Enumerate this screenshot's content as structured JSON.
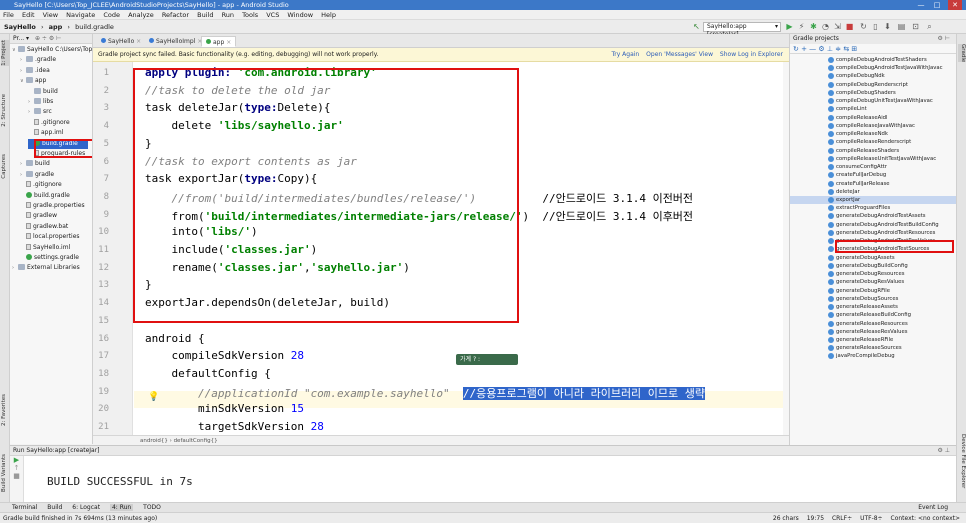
{
  "window": {
    "title": "SayHello [C:\\Users\\Top_JCLEE\\AndroidStudioProjects\\SayHello] - app - Android Studio",
    "minimize": "—",
    "maximize": "□",
    "close": "✕"
  },
  "menu": [
    "File",
    "Edit",
    "View",
    "Navigate",
    "Code",
    "Analyze",
    "Refactor",
    "Build",
    "Run",
    "Tools",
    "VCS",
    "Window",
    "Help"
  ],
  "breadcrumbs": [
    "SayHello",
    "app",
    "build.gradle"
  ],
  "run_config": "SayHello:app [createJar]",
  "left_tool_tabs": [
    "1: Project",
    "2: Structure",
    "Captures",
    "2: Favorites",
    "Build Variants"
  ],
  "right_tool_tabs": [
    "Gradle",
    "Device File Explorer"
  ],
  "project": {
    "header": "Pr... ▾",
    "tree": [
      {
        "label": "SayHello  C:\\Users\\Top",
        "indent": 0,
        "type": "folder",
        "arrow": "v"
      },
      {
        "label": ".gradle",
        "indent": 1,
        "type": "folder",
        "arrow": ">"
      },
      {
        "label": ".idea",
        "indent": 1,
        "type": "folder",
        "arrow": ">"
      },
      {
        "label": "app",
        "indent": 1,
        "type": "folder",
        "arrow": "v"
      },
      {
        "label": "build",
        "indent": 2,
        "type": "folder",
        "arrow": ""
      },
      {
        "label": "libs",
        "indent": 2,
        "type": "folder",
        "arrow": ">"
      },
      {
        "label": "src",
        "indent": 2,
        "type": "folder",
        "arrow": ">"
      },
      {
        "label": ".gitignore",
        "indent": 2,
        "type": "file",
        "arrow": ""
      },
      {
        "label": "app.iml",
        "indent": 2,
        "type": "file",
        "arrow": ""
      },
      {
        "label": "build.gradle",
        "indent": 2,
        "type": "gradle",
        "arrow": "",
        "selected": true
      },
      {
        "label": "proguard-rules",
        "indent": 2,
        "type": "file",
        "arrow": ""
      },
      {
        "label": "build",
        "indent": 1,
        "type": "folder",
        "arrow": ">"
      },
      {
        "label": "gradle",
        "indent": 1,
        "type": "folder",
        "arrow": ">"
      },
      {
        "label": ".gitignore",
        "indent": 1,
        "type": "file",
        "arrow": ""
      },
      {
        "label": "build.gradle",
        "indent": 1,
        "type": "gradle",
        "arrow": ""
      },
      {
        "label": "gradle.properties",
        "indent": 1,
        "type": "file",
        "arrow": ""
      },
      {
        "label": "gradlew",
        "indent": 1,
        "type": "file",
        "arrow": ""
      },
      {
        "label": "gradlew.bat",
        "indent": 1,
        "type": "file",
        "arrow": ""
      },
      {
        "label": "local.properties",
        "indent": 1,
        "type": "file",
        "arrow": ""
      },
      {
        "label": "SayHello.iml",
        "indent": 1,
        "type": "file",
        "arrow": ""
      },
      {
        "label": "settings.gradle",
        "indent": 1,
        "type": "gradle",
        "arrow": ""
      },
      {
        "label": "External Libraries",
        "indent": 0,
        "type": "folder",
        "arrow": ">"
      }
    ]
  },
  "tabs": [
    {
      "label": "SayHello",
      "active": false
    },
    {
      "label": "SayHelloImpl",
      "active": false
    },
    {
      "label": "app",
      "active": true
    }
  ],
  "sync_bar": {
    "message": "Gradle project sync failed. Basic functionality (e.g. editing, debugging) will not work properly.",
    "links": [
      "Try Again",
      "Open 'Messages' View",
      "Show Log in Explorer"
    ]
  },
  "code_lines": [
    {
      "n": "1",
      "tokens": [
        {
          "t": "apply plugin: ",
          "c": "kw"
        },
        {
          "t": "'com.android.library'",
          "c": "str"
        }
      ]
    },
    {
      "n": "2",
      "tokens": [
        {
          "t": "//task to delete the old jar",
          "c": "cmt"
        }
      ]
    },
    {
      "n": "3",
      "tokens": [
        {
          "t": "task deleteJar(",
          "c": ""
        },
        {
          "t": "type:",
          "c": "kw"
        },
        {
          "t": "Delete){",
          "c": ""
        }
      ]
    },
    {
      "n": "4",
      "tokens": [
        {
          "t": "    delete ",
          "c": ""
        },
        {
          "t": "'libs/sayhello.jar'",
          "c": "str"
        }
      ]
    },
    {
      "n": "5",
      "tokens": [
        {
          "t": "}",
          "c": ""
        }
      ]
    },
    {
      "n": "6",
      "tokens": [
        {
          "t": "//task to export contents as jar",
          "c": "cmt"
        }
      ]
    },
    {
      "n": "7",
      "tokens": [
        {
          "t": "task exportJar(",
          "c": ""
        },
        {
          "t": "type:",
          "c": "kw"
        },
        {
          "t": "Copy){",
          "c": ""
        }
      ]
    },
    {
      "n": "8",
      "tokens": [
        {
          "t": "    //from('build/intermediates/bundles/release/')",
          "c": "cmt"
        },
        {
          "t": "          //안드로이드 3.1.4 이전버전",
          "c": ""
        }
      ]
    },
    {
      "n": "9",
      "tokens": [
        {
          "t": "    from(",
          "c": ""
        },
        {
          "t": "'build/intermediates/intermediate-jars/release/'",
          "c": "str"
        },
        {
          "t": ")  //안드로이드 3.1.4 이후버전",
          "c": ""
        }
      ]
    },
    {
      "n": "10",
      "tokens": [
        {
          "t": "    into(",
          "c": ""
        },
        {
          "t": "'libs/'",
          "c": "str"
        },
        {
          "t": ")",
          "c": ""
        }
      ]
    },
    {
      "n": "11",
      "tokens": [
        {
          "t": "    include(",
          "c": ""
        },
        {
          "t": "'classes.jar'",
          "c": "str"
        },
        {
          "t": ")",
          "c": ""
        }
      ]
    },
    {
      "n": "12",
      "tokens": [
        {
          "t": "    rename(",
          "c": ""
        },
        {
          "t": "'classes.jar'",
          "c": "str"
        },
        {
          "t": ",",
          "c": ""
        },
        {
          "t": "'sayhello.jar'",
          "c": "str"
        },
        {
          "t": ")",
          "c": ""
        }
      ]
    },
    {
      "n": "13",
      "tokens": [
        {
          "t": "}",
          "c": ""
        }
      ]
    },
    {
      "n": "14",
      "tokens": [
        {
          "t": "exportJar.dependsOn(deleteJar, build)",
          "c": ""
        }
      ]
    },
    {
      "n": "15",
      "tokens": []
    },
    {
      "n": "16",
      "tokens": [
        {
          "t": "android {",
          "c": ""
        }
      ]
    },
    {
      "n": "17",
      "tokens": [
        {
          "t": "    compileSdkVersion ",
          "c": ""
        },
        {
          "t": "28",
          "c": "num"
        }
      ]
    },
    {
      "n": "18",
      "tokens": [
        {
          "t": "    defaultConfig {",
          "c": ""
        }
      ]
    },
    {
      "n": "19",
      "tokens": [
        {
          "t": "        //applicationId \"com.example.sayhello\"  ",
          "c": "cmt"
        },
        {
          "t": "//응용프로그램이 아니라 라이브러리 이므로 생략",
          "c": "hlcmt"
        }
      ]
    },
    {
      "n": "20",
      "tokens": [
        {
          "t": "        minSdkVersion ",
          "c": ""
        },
        {
          "t": "15",
          "c": "num"
        }
      ]
    },
    {
      "n": "21",
      "tokens": [
        {
          "t": "        targetSdkVersion ",
          "c": ""
        },
        {
          "t": "28",
          "c": "num"
        }
      ]
    }
  ],
  "popup_label": "가계 ? :",
  "editor_breadcrumb": "android{}  ›  defaultConfig{}",
  "gradle_panel": {
    "title": "Gradle projects",
    "tools": "↻  +  —  ⚙  ⊥  ≑  ⇆  ⊞",
    "tasks": [
      "compileDebugAndroidTestShaders",
      "compileDebugAndroidTestJavaWithJavac",
      "compileDebugNdk",
      "compileDebugRenderscript",
      "compileDebugShaders",
      "compileDebugUnitTestJavaWithJavac",
      "compileLint",
      "compileReleaseAidl",
      "compileReleaseJavaWithJavac",
      "compileReleaseNdk",
      "compileReleaseRenderscript",
      "compileReleaseShaders",
      "compileReleaseUnitTestJavaWithJavac",
      "consumeConfigAttr",
      "createFullJarDebug",
      "createFullJarRelease",
      "deleteJar",
      "exportJar",
      "extractProguardFiles",
      "generateDebugAndroidTestAssets",
      "generateDebugAndroidTestBuildConfig",
      "generateDebugAndroidTestResources",
      "generateDebugAndroidTestResValues",
      "generateDebugAndroidTestSources",
      "generateDebugAssets",
      "generateDebugBuildConfig",
      "generateDebugResources",
      "generateDebugResValues",
      "generateDebugRFile",
      "generateDebugSources",
      "generateReleaseAssets",
      "generateReleaseBuildConfig",
      "generateReleaseResources",
      "generateReleaseResValues",
      "generateReleaseRFile",
      "generateReleaseSources",
      "javaPreCompileDebug"
    ],
    "selected_task": "exportJar"
  },
  "run_panel": {
    "header": "Run  SayHello:app [createJar]",
    "output": "BUILD SUCCESSFUL in 7s"
  },
  "bottom_tabs": [
    "Terminal",
    "Build",
    "6: Logcat",
    "4: Run",
    "TODO"
  ],
  "event_log": "Event Log",
  "status": {
    "message": "Gradle build finished in 7s 694ms (13 minutes ago)",
    "chars": "26 chars",
    "position": "19:75",
    "line_sep": "CRLF÷",
    "encoding": "UTF-8÷",
    "context": "Context: <no context>"
  },
  "colors": {
    "keyword": "#000080",
    "string": "#008000",
    "comment": "#808080",
    "highlight_box": "#e01010",
    "selection": "#2f65ca"
  }
}
